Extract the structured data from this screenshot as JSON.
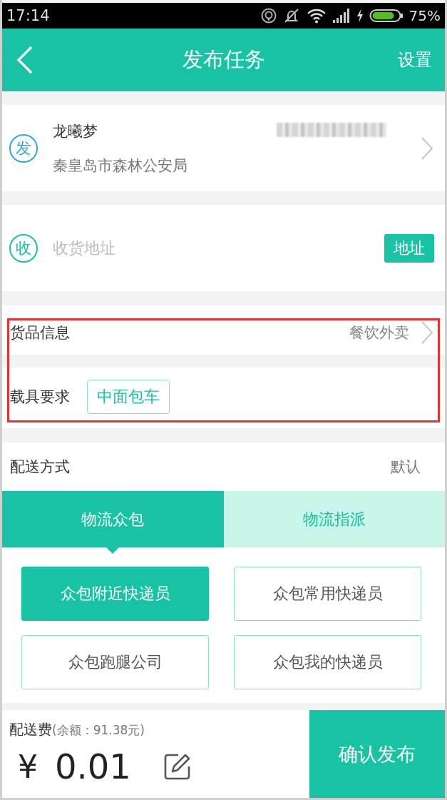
{
  "status_bar": {
    "time": "17:14",
    "battery": "75%"
  },
  "header": {
    "title": "发布任务",
    "action": "设置"
  },
  "sender": {
    "badge": "发",
    "name": "龙曦梦",
    "address": "秦皇岛市森林公安局"
  },
  "receiver": {
    "badge": "收",
    "prompt": "收货地址",
    "button": "地址"
  },
  "cargo": {
    "highlighted": true,
    "goods": {
      "label": "货品信息",
      "value": "餐饮外卖"
    },
    "vehicle": {
      "label": "载具要求",
      "tags": [
        {
          "label": "中面包车"
        }
      ]
    }
  },
  "delivery": {
    "label": "配送方式",
    "value": "默认",
    "tabs": [
      {
        "label": "物流众包",
        "selected": true
      },
      {
        "label": "物流指派",
        "selected": false
      }
    ],
    "options": [
      {
        "label": "众包附近快递员",
        "selected": true
      },
      {
        "label": "众包常用快递员",
        "selected": false
      },
      {
        "label": "众包跑腿公司",
        "selected": false
      },
      {
        "label": "众包我的快递员",
        "selected": false
      }
    ]
  },
  "footer": {
    "fee_label": "配送费",
    "balance": "(余额：91.38元)",
    "currency": "¥",
    "amount": "0.01",
    "confirm": "确认发布"
  }
}
